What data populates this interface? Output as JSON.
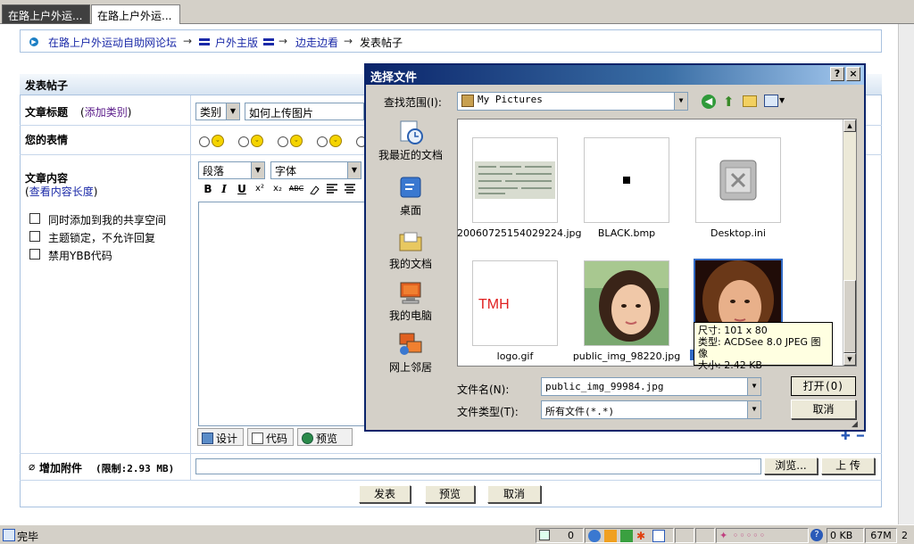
{
  "browser": {
    "tabs": [
      {
        "label": "在路上户外运..."
      },
      {
        "label": "在路上户外运..."
      }
    ]
  },
  "breadcrumb": {
    "forum": "在路上户外运动自助网论坛",
    "section": "户外主版",
    "subforum": "边走边看",
    "current": "发表帖子",
    "sep": "→"
  },
  "form": {
    "header": "发表帖子",
    "title_label": "文章标题",
    "add_category": "添加类别",
    "category_select": "类别",
    "title_value": "如何上传图片",
    "mood_label": "您的表情",
    "content_label": "文章内容",
    "view_length": "查看内容长度",
    "paragraph_select": "段落",
    "font_select": "字体",
    "toolbar": {
      "bold": "B",
      "italic": "I",
      "underline": "U",
      "superscript": "x²",
      "subscript": "x₂",
      "strike": "ABC"
    },
    "options": [
      {
        "label": "同时添加到我的共享空间"
      },
      {
        "label": "主题锁定，不允许回复"
      },
      {
        "label": "禁用YBB代码"
      }
    ],
    "modes": {
      "design": "设计",
      "code": "代码",
      "preview": "预览"
    },
    "attachment_label": "增加附件",
    "attachment_limit": "(限制:2.93 MB)",
    "browse_button": "浏览...",
    "upload_button": "上 传",
    "submit_button": "发表",
    "preview_button": "预览",
    "cancel_button": "取消"
  },
  "dialog": {
    "title": "选择文件",
    "help": "?",
    "close": "×",
    "look_in_label": "查找范围(I):",
    "look_in_value": "My Pictures",
    "places": [
      {
        "label": "我最近的文档",
        "icon": "recent-docs-icon"
      },
      {
        "label": "桌面",
        "icon": "desktop-icon"
      },
      {
        "label": "我的文档",
        "icon": "my-documents-icon"
      },
      {
        "label": "我的电脑",
        "icon": "my-computer-icon"
      },
      {
        "label": "网上邻居",
        "icon": "network-places-icon"
      }
    ],
    "files": [
      {
        "name": "20060725154029224.jpg"
      },
      {
        "name": "BLACK.bmp"
      },
      {
        "name": "Desktop.ini"
      },
      {
        "name": "logo.gif",
        "thumb_text": "TMH"
      },
      {
        "name": "public_img_98220.jpg"
      },
      {
        "name": "public_img_99984.jpg"
      }
    ],
    "tooltip": {
      "size": "尺寸: 101 x 80",
      "type": "类型: ACDSee 8.0 JPEG 图像",
      "filesize": "大小: 2.42 KB"
    },
    "filename_label": "文件名(N):",
    "filename_value": "public_img_99984.jpg",
    "filetype_label": "文件类型(T):",
    "filetype_value": "所有文件(*.*)",
    "open_button": "打开(O)",
    "cancel_button": "取消"
  },
  "statusbar": {
    "status": "完毕",
    "count": "0",
    "kb": "0 KB",
    "memory": "67M",
    "extra": "2"
  }
}
